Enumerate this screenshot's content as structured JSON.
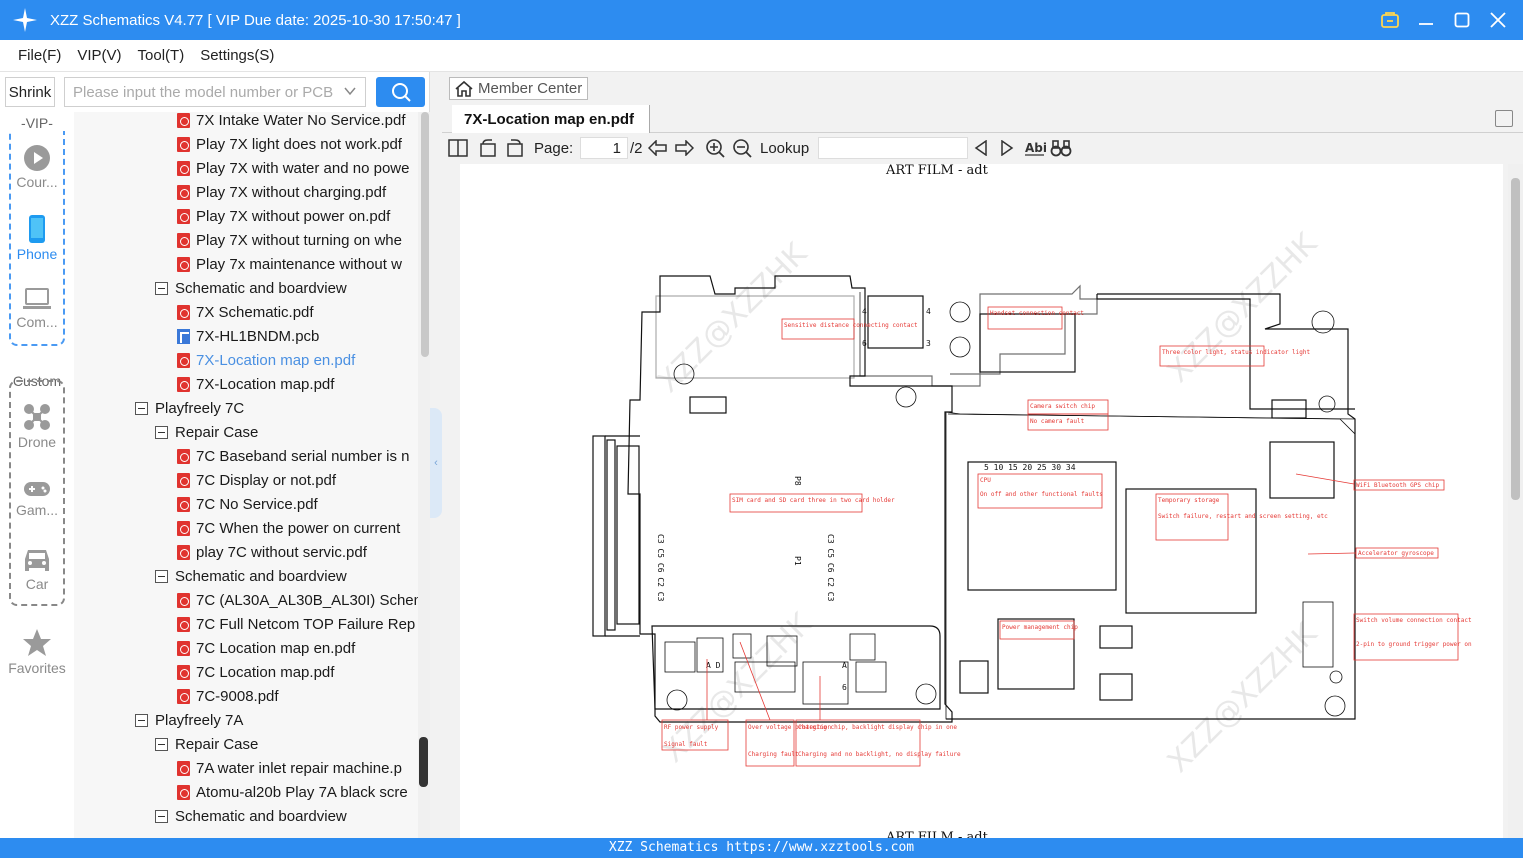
{
  "app": {
    "title": "XZZ Schematics V4.77 [ VIP Due date: 2025-10-30 17:50:47 ]"
  },
  "menu": [
    "File(F)",
    "VIP(V)",
    "Tool(T)",
    "Settings(S)"
  ],
  "search": {
    "shrink_label": "Shrink",
    "placeholder": "Please input the model number or PCB"
  },
  "nav": {
    "vip_label": "VIP",
    "custom_label": "Custom",
    "items": [
      "Cour...",
      "Phone",
      "Com...",
      "Drone",
      "Gam...",
      "Car",
      "Favorites"
    ]
  },
  "tree": [
    {
      "label": "7X Intake Water No Service.pdf"
    },
    {
      "label": "Play 7X light does not work.pdf"
    },
    {
      "label": "Play 7X with water and no powe"
    },
    {
      "label": "Play 7X without charging.pdf"
    },
    {
      "label": "Play 7X without power on.pdf"
    },
    {
      "label": "Play 7X without turning on whe"
    },
    {
      "label": "Play 7x maintenance without w"
    },
    {
      "label": "Schematic and boardview"
    },
    {
      "label": "7X Schematic.pdf"
    },
    {
      "label": "7X-HL1BNDM.pcb"
    },
    {
      "label": "7X-Location map en.pdf"
    },
    {
      "label": "7X-Location map.pdf"
    },
    {
      "label": "Playfreely 7C"
    },
    {
      "label": "Repair Case"
    },
    {
      "label": "7C Baseband serial number is n"
    },
    {
      "label": "7C Display or not.pdf"
    },
    {
      "label": "7C No Service.pdf"
    },
    {
      "label": "7C When the power on current"
    },
    {
      "label": "play 7C without servic.pdf"
    },
    {
      "label": "Schematic and boardview"
    },
    {
      "label": "7C (AL30A_AL30B_AL30I) Schem"
    },
    {
      "label": "7C Full Netcom TOP Failure Rep"
    },
    {
      "label": "7C Location map en.pdf"
    },
    {
      "label": "7C Location map.pdf"
    },
    {
      "label": "7C-9008.pdf"
    },
    {
      "label": "Playfreely 7A"
    },
    {
      "label": "Repair Case"
    },
    {
      "label": "7A water inlet repair machine.p"
    },
    {
      "label": "Atomu-al20b Play 7A black scre"
    },
    {
      "label": "Schematic and boardview"
    }
  ],
  "viewer": {
    "member_center": "Member Center",
    "tab_title": "7X-Location map en.pdf",
    "page_label": "Page:",
    "page_current": "1",
    "page_total": "/2",
    "lookup_label": "Lookup",
    "doc_header": "ART FILM - adt",
    "doc_footer": "ART FILM - adt",
    "watermark": "XZZ@XZZHK",
    "annotations": [
      "Sensitive distance connecting contact",
      "Handset connection contact",
      "Three color light, status indicator light",
      "Camera switch chip",
      "No camera fault",
      "CPU",
      "On off and other functional faults",
      "Temporary storage",
      "Switch failure, restart and screen setting, etc",
      "WiFi Bluetooth GPS chip",
      "SIM card and SD card three in two card holder",
      "Accelerator gyroscope",
      "Switch volume connection contact",
      "2-pin to ground trigger power on",
      "Power management chip",
      "RF power supply",
      "Signal fault",
      "Over voltage protection",
      "Charging fault",
      "Charging chip, backlight display chip in one",
      "Charging and no backlight, no display failure"
    ]
  },
  "statusbar": "XZZ Schematics https://www.xzztools.com",
  "colors": {
    "accent": "#2d8cf0",
    "pdf_icon": "#e0332f",
    "selected_text": "#4a90e2",
    "annotation": "#e53935"
  }
}
